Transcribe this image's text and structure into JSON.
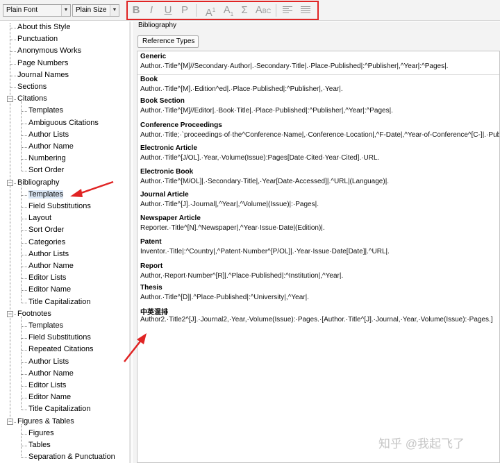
{
  "toolbar": {
    "font": "Plain Font",
    "size": "Plain Size",
    "buttons": [
      "B",
      "I",
      "U",
      "P"
    ],
    "superscript_base": "A",
    "superscript_mark": "1",
    "subscript_base": "A",
    "subscript_mark": "1",
    "sigma": "Σ",
    "smallcaps_big": "A",
    "smallcaps_small": "BC"
  },
  "tree": {
    "items": [
      "About this Style",
      "Punctuation",
      "Anonymous Works",
      "Page Numbers",
      "Journal Names",
      "Sections",
      "Citations",
      "Templates",
      "Ambiguous Citations",
      "Author Lists",
      "Author Name",
      "Numbering",
      "Sort Order",
      "Bibliography",
      "Templates",
      "Field Substitutions",
      "Layout",
      "Sort Order",
      "Categories",
      "Author Lists",
      "Author Name",
      "Editor Lists",
      "Editor Name",
      "Title Capitalization",
      "Footnotes",
      "Templates",
      "Field Substitutions",
      "Repeated Citations",
      "Author Lists",
      "Author Name",
      "Editor Lists",
      "Editor Name",
      "Title Capitalization",
      "Figures & Tables",
      "Figures",
      "Tables",
      "Separation & Punctuation"
    ]
  },
  "panel": {
    "label": "Bibliography",
    "ref_types_button": "Reference Types"
  },
  "templates": [
    {
      "type": "Generic",
      "text": "Author.·Title^[M]//Secondary·Author|.·Secondary·Title|.·Place·Published|:^Publisher|,^Year|:^Pages|."
    },
    {
      "type": "Book",
      "text": "Author.·Title^[M].·Edition^ed|.·Place·Published|:^Publisher|,·Year|."
    },
    {
      "type": "Book Section",
      "text": "Author.·Title^[M]//Editor|.·Book·Title|.·Place·Published|:^Publisher|,^Year|:^Pages|."
    },
    {
      "type": "Conference Proceedings",
      "text": "Author.·Title;·`proceedings·of·the^Conference·Name|,·Conference·Location|,^F-Date|,^Year-of-Conference^[C-]|.·Publ"
    },
    {
      "type": "Electronic Article",
      "text": "Author.·Title^[J/OL].·Year,·Volume(Issue):Pages[Date·Cited·Year·Cited].·URL."
    },
    {
      "type": "Electronic Book",
      "text": "Author.·Title^[M/OL]|.·Secondary·Title|,·Year[Date·Accessed]|.^URL|(Language)|."
    },
    {
      "type": "Journal Article",
      "text": "Author.·Title^[J].·Journal|,^Year|,^Volume|(Issue)|:·Pages|."
    },
    {
      "type": "Newspaper Article",
      "text": "Reporter.·Title^[N].^Newspaper|,^Year·Issue·Date|(Edition)|."
    },
    {
      "type": "Patent",
      "text": "Inventor.·Title|:^Country|,^Patent·Number^[P/OL]|.·Year·Issue·Date[Date]|.^URL|."
    },
    {
      "type": "Report",
      "text": "Author,·Report·Number^[R]|.^Place·Published|:^Institution|,^Year|."
    },
    {
      "type": "Thesis",
      "text": "Author.·Title^[D]|.^Place·Published|:^University|,^Year|."
    },
    {
      "type": "中英混排",
      "text": "Author2.·Title2^[J].·Journal2,·Year,·Volume(Issue):·Pages.·[Author.·Title^[J].·Journal,·Year,·Volume(Issue):·Pages.]"
    }
  ],
  "watermark": "知乎 @我起飞了",
  "colors": {
    "highlight_box": "#e02424",
    "arrow": "#e02424",
    "selection": "#dce8f6"
  }
}
